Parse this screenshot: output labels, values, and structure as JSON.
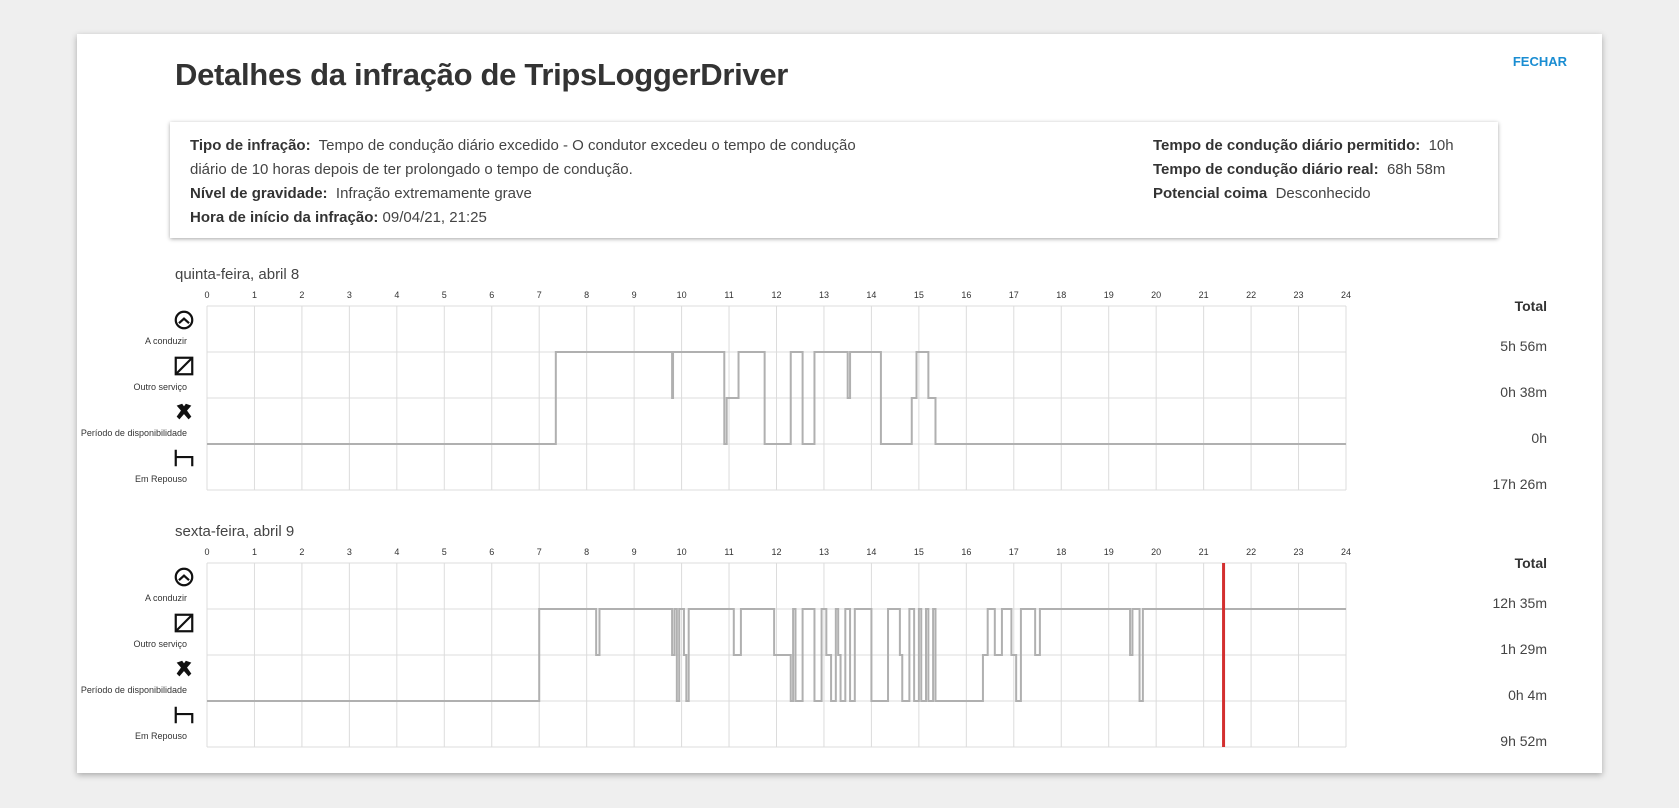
{
  "dialog": {
    "title": "Detalhes da infração de TripsLoggerDriver",
    "close_label": "FECHAR"
  },
  "summary": {
    "infraction_type_label": "Tipo de infração:",
    "infraction_type_value": "Tempo de condução diário excedido -  O condutor excedeu o tempo de condução diário de 10 horas depois de ter prolongado o tempo de condução.",
    "severity_label": "Nível de gravidade:",
    "severity_value": "Infração extremamente grave",
    "start_label": "Hora de início da infração:",
    "start_value": "09/04/21, 21:25",
    "allowed_label": "Tempo de condução diário permitido:",
    "allowed_value": "10h",
    "actual_label": "Tempo de condução diário real:",
    "actual_value": "68h 58m",
    "fine_label": "Potencial coima",
    "fine_value": "Desconhecido"
  },
  "row_labels": [
    "A conduzir",
    "Outro serviço",
    "Período de disponibilidade",
    "Em Repouso"
  ],
  "row_icons": [
    "steering-wheel-icon",
    "other-work-icon",
    "hammer-pick-icon",
    "bed-icon"
  ],
  "total_header": "Total",
  "hours": [
    "0",
    "1",
    "2",
    "3",
    "4",
    "5",
    "6",
    "7",
    "8",
    "9",
    "10",
    "11",
    "12",
    "13",
    "14",
    "15",
    "16",
    "17",
    "18",
    "19",
    "20",
    "21",
    "22",
    "23",
    "24"
  ],
  "colors": {
    "line": "#b0b0b0",
    "grid": "#dcdcdc",
    "marker": "#d32f2f",
    "link": "#1a8dd2"
  },
  "chart_data": [
    {
      "type": "line",
      "title": "quinta-feira, abril 8",
      "categories": [
        "A conduzir",
        "Outro serviço",
        "Período de disponibilidade",
        "Em Repouso"
      ],
      "totals": [
        "5h 56m",
        "0h 38m",
        "0h",
        "17h 26m"
      ],
      "xlim": [
        0,
        24
      ],
      "steps": [
        [
          0,
          3
        ],
        [
          7.35,
          1
        ],
        [
          9.8,
          2
        ],
        [
          9.82,
          1
        ],
        [
          10.9,
          3
        ],
        [
          10.95,
          2
        ],
        [
          11.2,
          1
        ],
        [
          11.75,
          3
        ],
        [
          12.3,
          1
        ],
        [
          12.55,
          3
        ],
        [
          12.8,
          1
        ],
        [
          13.5,
          2
        ],
        [
          13.55,
          1
        ],
        [
          14.2,
          3
        ],
        [
          14.85,
          2
        ],
        [
          14.95,
          1
        ],
        [
          15.2,
          2
        ],
        [
          15.35,
          3
        ],
        [
          24,
          3
        ]
      ]
    },
    {
      "type": "line",
      "title": "sexta-feira, abril 9",
      "categories": [
        "A conduzir",
        "Outro serviço",
        "Período de disponibilidade",
        "Em Repouso"
      ],
      "totals": [
        "12h 35m",
        "1h 29m",
        "0h 4m",
        "9h 52m"
      ],
      "xlim": [
        0,
        24
      ],
      "marker": 21.42,
      "steps": [
        [
          0,
          3
        ],
        [
          7,
          1
        ],
        [
          8.2,
          2
        ],
        [
          8.27,
          1
        ],
        [
          9.8,
          2
        ],
        [
          9.85,
          1
        ],
        [
          9.9,
          3
        ],
        [
          9.95,
          1
        ],
        [
          10.05,
          2
        ],
        [
          10.1,
          3
        ],
        [
          10.15,
          1
        ],
        [
          11.1,
          2
        ],
        [
          11.25,
          1
        ],
        [
          11.95,
          2
        ],
        [
          12.3,
          3
        ],
        [
          12.35,
          1
        ],
        [
          12.4,
          3
        ],
        [
          12.55,
          1
        ],
        [
          12.8,
          3
        ],
        [
          12.95,
          1
        ],
        [
          13.05,
          2
        ],
        [
          13.15,
          3
        ],
        [
          13.25,
          1
        ],
        [
          13.3,
          2
        ],
        [
          13.35,
          3
        ],
        [
          13.45,
          1
        ],
        [
          13.55,
          3
        ],
        [
          13.65,
          1
        ],
        [
          14,
          3
        ],
        [
          14.35,
          1
        ],
        [
          14.6,
          2
        ],
        [
          14.65,
          3
        ],
        [
          14.8,
          1
        ],
        [
          14.9,
          3
        ],
        [
          15,
          1
        ],
        [
          15.05,
          3
        ],
        [
          15.15,
          1
        ],
        [
          15.2,
          3
        ],
        [
          15.3,
          1
        ],
        [
          15.35,
          3
        ],
        [
          16.35,
          2
        ],
        [
          16.45,
          1
        ],
        [
          16.6,
          2
        ],
        [
          16.75,
          1
        ],
        [
          16.95,
          2
        ],
        [
          17.05,
          3
        ],
        [
          17.15,
          1
        ],
        [
          17.45,
          2
        ],
        [
          17.55,
          1
        ],
        [
          19.45,
          2
        ],
        [
          19.5,
          1
        ],
        [
          19.65,
          3
        ],
        [
          19.72,
          1
        ],
        [
          24,
          1
        ]
      ]
    }
  ]
}
